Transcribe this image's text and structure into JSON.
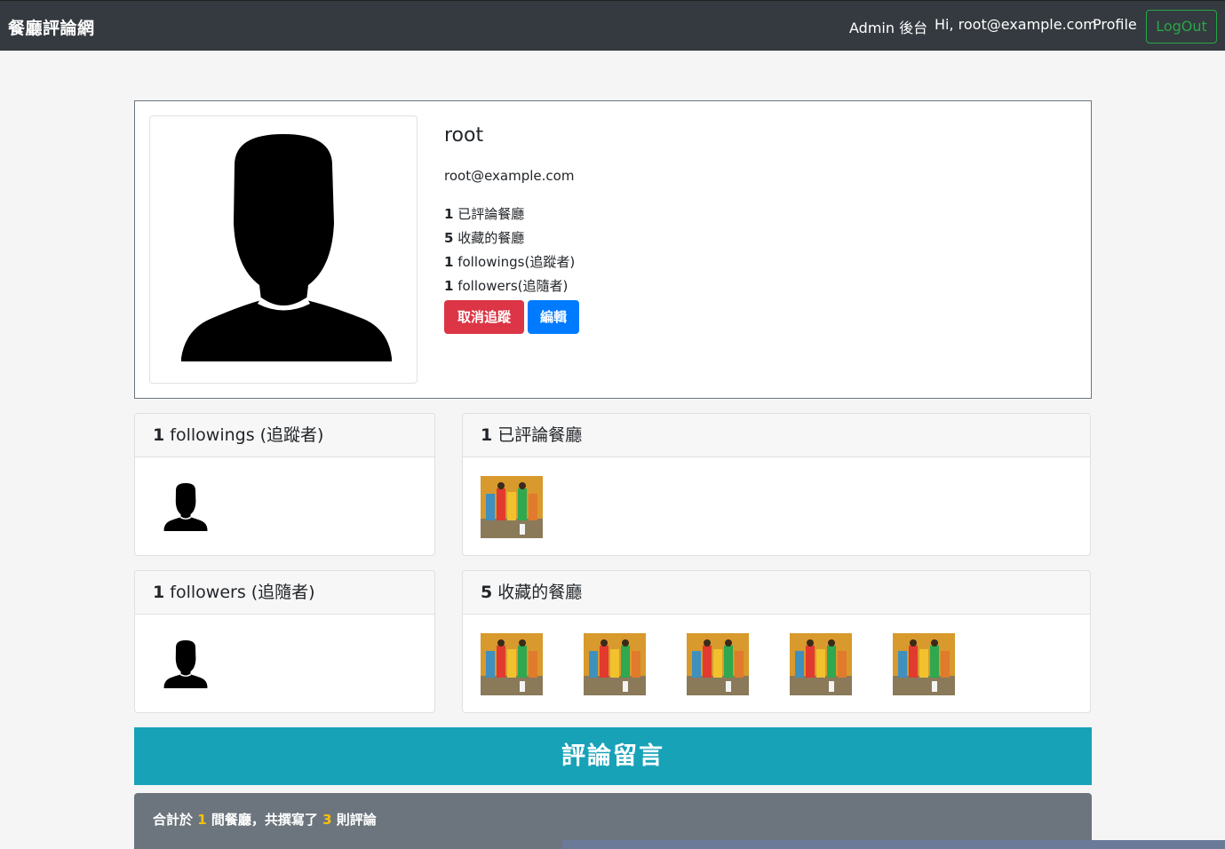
{
  "navbar": {
    "brand": "餐廳評論網",
    "admin_link": "Admin 後台",
    "greeting": "Hi, root@example.com",
    "profile_link": "Profile",
    "logout_label": "LogOut"
  },
  "profile": {
    "name": "root",
    "email": "root@example.com",
    "stats": [
      {
        "count": "1",
        "label": "已評論餐廳"
      },
      {
        "count": "5",
        "label": "收藏的餐廳"
      },
      {
        "count": "1",
        "label": "followings(追蹤者)"
      },
      {
        "count": "1",
        "label": "followers(追隨者)"
      }
    ],
    "unfollow_label": "取消追蹤",
    "edit_label": "編輯"
  },
  "followings_card": {
    "count": "1",
    "title": "followings (追蹤者)"
  },
  "reviewed_card": {
    "count": "1",
    "title": "已評論餐廳"
  },
  "followers_card": {
    "count": "1",
    "title": "followers (追隨者)"
  },
  "favorites_card": {
    "count": "5",
    "title": "收藏的餐廳"
  },
  "comments_banner": "評論留言",
  "summary": {
    "prefix": "合計於 ",
    "restaurants": "1",
    "middle": " 間餐廳，共撰寫了 ",
    "comments": "3",
    "suffix": " 則評論"
  },
  "colors": {
    "navbar": "#343a40",
    "danger": "#dc3545",
    "primary": "#007bff",
    "success": "#28a745",
    "info": "#17a2b8",
    "secondary": "#6c757d",
    "warning": "#ffc107"
  },
  "icons": [
    "user-silhouette-icon",
    "restaurant-photo"
  ]
}
